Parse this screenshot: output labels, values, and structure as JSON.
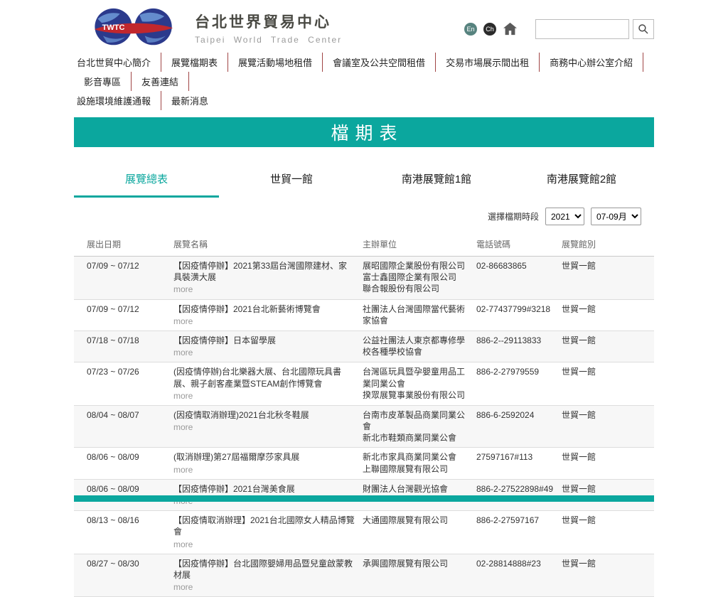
{
  "colors": {
    "teal": "#0BA79E",
    "nav_separator": "#A04545",
    "row_alt": "#F7F7F7"
  },
  "header": {
    "logo_text": "TWTC",
    "title_zh": "台北世界貿易中心",
    "title_en": "Taipei World Trade Center",
    "lang_en": "En",
    "lang_ch": "Ch"
  },
  "nav": {
    "rows": [
      [
        "台北世貿中心簡介",
        "展覽檔期表",
        "展覽活動場地租借",
        "會議室及公共空間租借",
        "交易市場展示間出租",
        "商務中心辦公室介紹",
        "影音專區",
        "友善連結"
      ],
      [
        "設施環境維護通報",
        "最新消息"
      ]
    ]
  },
  "banner": {
    "title": "檔期表"
  },
  "tabs": [
    {
      "label": "展覽總表",
      "active": true
    },
    {
      "label": "世貿一館",
      "active": false
    },
    {
      "label": "南港展覽館1館",
      "active": false
    },
    {
      "label": "南港展覽館2館",
      "active": false
    }
  ],
  "filter": {
    "label": "選擇檔期時段",
    "year": "2021",
    "period": "07-09月"
  },
  "table": {
    "headers": [
      "展出日期",
      "展覽名稱",
      "主辦單位",
      "電話號碼",
      "展覽館別"
    ],
    "more_label": "more",
    "rows": [
      {
        "date": "07/09 ~ 07/12",
        "name": "【因疫情停辦】2021第33屆台灣國際建材、家具裝潢大展",
        "organizers": [
          "展昭國際企業股份有限公司",
          "富士鑫國際企業有限公司",
          "聯合報股份有限公司"
        ],
        "phone": "02-86683865",
        "venue": "世貿一館"
      },
      {
        "date": "07/09 ~ 07/12",
        "name": "【因疫情停辦】2021台北新藝術博覽會",
        "organizers": [
          "社團法人台灣國際當代藝術家協會"
        ],
        "phone": "02-77437799#3218",
        "venue": "世貿一館"
      },
      {
        "date": "07/18 ~ 07/18",
        "name": "【因疫情停辦】日本留學展",
        "organizers": [
          "公益社團法人東京都專修學校各種學校協會"
        ],
        "phone": "886-2--29113833",
        "venue": "世貿一館"
      },
      {
        "date": "07/23 ~ 07/26",
        "name": "(因疫情停辦)台北樂器大展、台北國際玩具書展、親子創客產業暨STEAM創作博覽會",
        "organizers": [
          "台灣區玩具暨孕嬰童用品工業同業公會",
          "揆眾展覽事業股份有限公司"
        ],
        "phone": "886-2-27979559",
        "venue": "世貿一館"
      },
      {
        "date": "08/04 ~ 08/07",
        "name": "(因疫情取消辦理)2021台北秋冬鞋展",
        "organizers": [
          "台南市皮革製品商業同業公會",
          "新北市鞋類商業同業公會"
        ],
        "phone": "886-6-2592024",
        "venue": "世貿一館"
      },
      {
        "date": "08/06 ~ 08/09",
        "name": "(取消辦理)第27屆福爾摩莎家具展",
        "organizers": [
          "新北市家具商業同業公會",
          "上聯國際展覽有限公司"
        ],
        "phone": "27597167#113",
        "venue": "世貿一館"
      },
      {
        "date": "08/06 ~ 08/09",
        "name": "【因疫情停辦】2021台灣美食展",
        "organizers": [
          "財團法人台灣觀光協會"
        ],
        "phone": "886-2-27522898#49",
        "venue": "世貿一館"
      },
      {
        "date": "08/13 ~ 08/16",
        "name": "【因疫情取消辦理】2021台北國際女人精品博覽會",
        "organizers": [
          "大通國際展覽有限公司"
        ],
        "phone": "886-2-27597167",
        "venue": "世貿一館"
      },
      {
        "date": "08/27 ~ 08/30",
        "name": "【因疫情停辦】台北國際嬰婦用品暨兒童啟蒙教材展",
        "organizers": [
          "承興國際展覽有限公司"
        ],
        "phone": "02-28814888#23",
        "venue": "世貿一館"
      }
    ]
  }
}
